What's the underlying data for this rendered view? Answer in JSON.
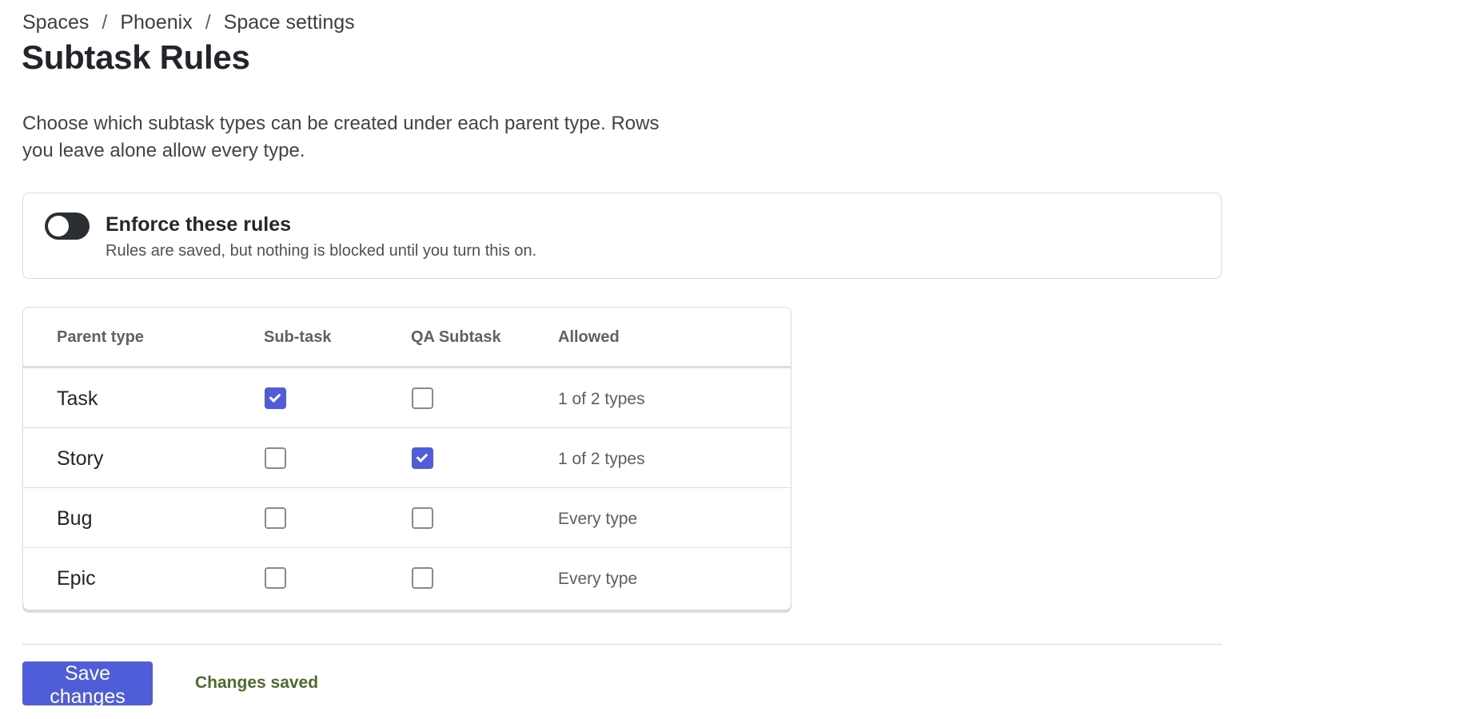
{
  "breadcrumb": {
    "items": [
      "Spaces",
      "Phoenix",
      "Space settings"
    ],
    "separator": "/"
  },
  "page": {
    "title": "Subtask Rules",
    "description": "Choose which subtask types can be created under each parent type. Rows you leave alone allow every type."
  },
  "enforce": {
    "title": "Enforce these rules",
    "subtitle": "Rules are saved, but nothing is blocked until you turn this on.",
    "enabled": false
  },
  "table": {
    "headers": {
      "parent": "Parent type",
      "subtask": "Sub-task",
      "qa": "QA Subtask",
      "allowed": "Allowed"
    },
    "rows": [
      {
        "parent": "Task",
        "subtask": true,
        "qa": false,
        "allowed": "1 of 2 types"
      },
      {
        "parent": "Story",
        "subtask": false,
        "qa": true,
        "allowed": "1 of 2 types"
      },
      {
        "parent": "Bug",
        "subtask": false,
        "qa": false,
        "allowed": "Every type"
      },
      {
        "parent": "Epic",
        "subtask": false,
        "qa": false,
        "allowed": "Every type"
      }
    ]
  },
  "footer": {
    "save_label": "Save changes",
    "status": "Changes saved"
  },
  "colors": {
    "accent": "#4f5ed8",
    "toggle_off": "#2b2e33",
    "status_text": "#4e6b2a"
  }
}
